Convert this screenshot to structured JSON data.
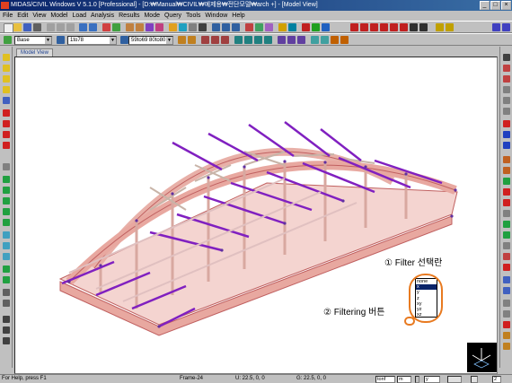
{
  "window": {
    "title": "MIDAS/CIVIL Windows V 5.1.0 [Professional] - [D:₩Manual₩CIVIL₩예제용₩전단모델₩arch +] - [Model View]",
    "minimize": "_",
    "maximize": "□",
    "close": "×"
  },
  "menu": {
    "items": [
      "File",
      "Edit",
      "View",
      "Model",
      "Load",
      "Analysis",
      "Results",
      "Mode",
      "Query",
      "Tools",
      "Window",
      "Help"
    ]
  },
  "toolbar2": {
    "base_combo": "Base",
    "section_combo": "1to78",
    "size_combo": "59to69 80to80 11"
  },
  "tabs": {
    "model_view": "Model View"
  },
  "annotations": {
    "filter_label": "① Filter 선택란",
    "filtering_button_label": "② Filtering 버튼"
  },
  "filter_list": {
    "options": [
      "none",
      "x",
      "y",
      "z",
      "xy",
      "yz",
      "xz"
    ],
    "selected_index": 1
  },
  "status": {
    "help": "For Help, press F1",
    "frame": "Frame-24",
    "u_coord": "U: 22.5, 0, 0",
    "g_coord": "G: 22.5, 0, 0",
    "unit_force": "tonf",
    "unit_length": "m",
    "filter_value": "y",
    "page": "2"
  },
  "colors": {
    "titlebar": "#0a246a",
    "deck_member": "#e8a8a0",
    "member_edge": "#c06060",
    "bracing": "#a8c8e0",
    "crossbeam": "#8020c0",
    "annotation_ring": "#e87a20"
  }
}
